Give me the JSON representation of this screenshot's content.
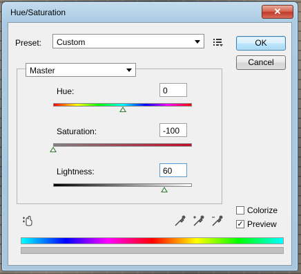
{
  "window": {
    "title": "Hue/Saturation",
    "close_label": "✕"
  },
  "preset": {
    "label": "Preset:",
    "value": "Custom"
  },
  "buttons": {
    "ok": "OK",
    "cancel": "Cancel"
  },
  "channel": {
    "value": "Master"
  },
  "hue": {
    "label": "Hue:",
    "value": "0",
    "level": 0.5
  },
  "saturation": {
    "label": "Saturation:",
    "value": "-100",
    "level": 0.0
  },
  "lightness": {
    "label": "Lightness:",
    "value": "60",
    "level": 0.8
  },
  "options": {
    "colorize": "Colorize",
    "colorize_checked": false,
    "preview": "Preview",
    "preview_checked": true
  },
  "colors": {
    "thumb": "#2e7d32",
    "saturation_end": "#c60b2a",
    "ok_border": "#3c7fb1"
  }
}
